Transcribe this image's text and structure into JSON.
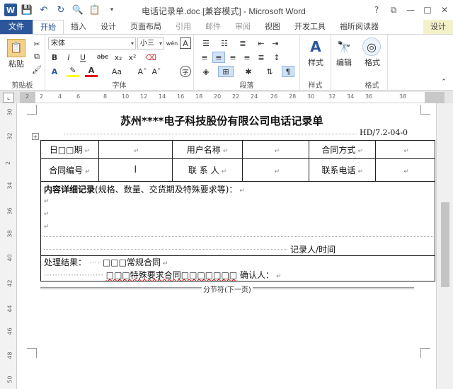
{
  "titlebar": {
    "app_icon": "W",
    "title": "电话记录单.doc [兼容模式] - Microsoft Word",
    "icons": [
      "save-icon",
      "undo-icon",
      "redo-icon",
      "print-preview-icon",
      "paste-icon"
    ],
    "controls": [
      "?",
      "⧉",
      "—",
      "□",
      "✕"
    ]
  },
  "tabs": [
    "文件",
    "开始",
    "插入",
    "设计",
    "页面布局",
    "引用",
    "邮件",
    "审阅",
    "视图",
    "开发工具",
    "福昕阅读器",
    "设计"
  ],
  "ribbon": {
    "clipboard": {
      "label": "剪贴板",
      "paste": "粘贴"
    },
    "font": {
      "label": "字体",
      "font_name": "宋体",
      "font_size": "小三",
      "wen": "wén",
      "A_box": "A",
      "bold": "B",
      "italic": "I",
      "underline": "U",
      "strike": "abc",
      "sub": "x₂",
      "sup": "x²",
      "aa_case": "Aa",
      "grow": "Aˆ",
      "shrink": "Aˇ",
      "circle_char": "字"
    },
    "paragraph": {
      "label": "段落"
    },
    "styles": {
      "label": "样式",
      "button": "样式"
    },
    "editing": {
      "button": "编辑"
    },
    "format": {
      "label": "格式",
      "button": "格式"
    }
  },
  "ruler": {
    "numbers": [
      "2",
      "2",
      "4",
      "6",
      "8",
      "10",
      "12",
      "14",
      "16",
      "18",
      "20",
      "22",
      "24",
      "26",
      "28",
      "30",
      "32",
      "34",
      "36",
      "38"
    ]
  },
  "vruler": {
    "numbers": [
      "30",
      "32",
      "2",
      "34",
      "36",
      "38",
      "40",
      "42",
      "44",
      "46",
      "48",
      "50"
    ]
  },
  "document": {
    "title": "苏州****电子科技股份有限公司电话记录单",
    "code": "HD/7.2-04-0",
    "table": {
      "row1": [
        "日□□期",
        "",
        "用户名称",
        "",
        "合同方式",
        ""
      ],
      "row2": [
        "合同编号",
        "",
        "联 系 人",
        "",
        "联系电话",
        ""
      ]
    },
    "detail_bold": "内容详细记录",
    "detail_rest": "(规格、数量、交货期及特殊要求等)：",
    "recorder": "记录人/时间",
    "result_label": "处理结果：",
    "option1": "□□□常规合同",
    "option2": "□□□特殊要求合同□□□□□□□",
    "confirm": "确认人：",
    "section_break": "分节符(下一页)"
  }
}
